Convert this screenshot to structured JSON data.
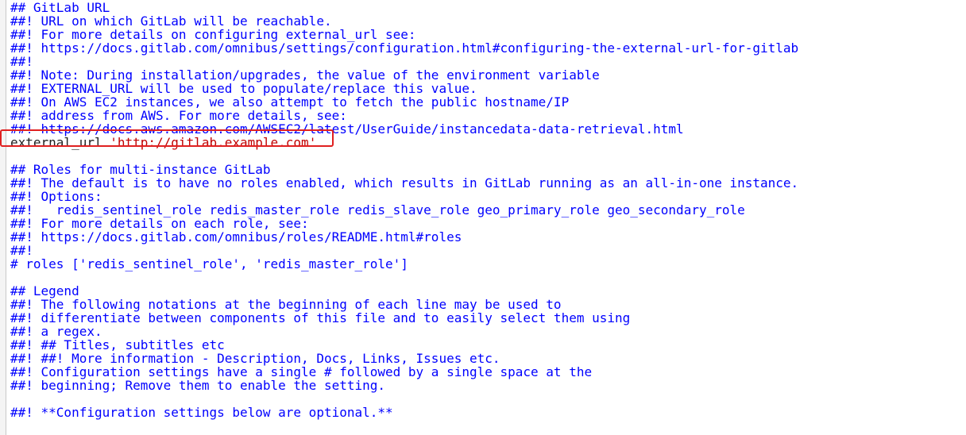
{
  "editor": {
    "lines": [
      {
        "text": "## GitLab URL"
      },
      {
        "text": "##! URL on which GitLab will be reachable."
      },
      {
        "text": "##! For more details on configuring external_url see:"
      },
      {
        "text": "##! https://docs.gitlab.com/omnibus/settings/configuration.html#configuring-the-external-url-for-gitlab"
      },
      {
        "text": "##!"
      },
      {
        "text": "##! Note: During installation/upgrades, the value of the environment variable"
      },
      {
        "text": "##! EXTERNAL_URL will be used to populate/replace this value."
      },
      {
        "text": "##! On AWS EC2 instances, we also attempt to fetch the public hostname/IP"
      },
      {
        "text": "##! address from AWS. For more details, see:"
      },
      {
        "text": "##! https://docs.aws.amazon.com/AWSEC2/latest/UserGuide/instancedata-data-retrieval.html"
      },
      {
        "text": "external_url ",
        "string": "'http://gitlab.example.com'"
      },
      {
        "text": ""
      },
      {
        "text": "## Roles for multi-instance GitLab"
      },
      {
        "text": "##! The default is to have no roles enabled, which results in GitLab running as an all-in-one instance."
      },
      {
        "text": "##! Options:"
      },
      {
        "text": "##!   redis_sentinel_role redis_master_role redis_slave_role geo_primary_role geo_secondary_role"
      },
      {
        "text": "##! For more details on each role, see:"
      },
      {
        "text": "##! https://docs.gitlab.com/omnibus/roles/README.html#roles"
      },
      {
        "text": "##!"
      },
      {
        "text": "# roles ['redis_sentinel_role', 'redis_master_role']"
      },
      {
        "text": ""
      },
      {
        "text": "## Legend"
      },
      {
        "text": "##! The following notations at the beginning of each line may be used to"
      },
      {
        "text": "##! differentiate between components of this file and to easily select them using"
      },
      {
        "text": "##! a regex."
      },
      {
        "text": "##! ## Titles, subtitles etc"
      },
      {
        "text": "##! ##! More information - Description, Docs, Links, Issues etc."
      },
      {
        "text": "##! Configuration settings have a single # followed by a single space at the"
      },
      {
        "text": "##! beginning; Remove them to enable the setting."
      },
      {
        "text": ""
      },
      {
        "text": "##! **Configuration settings below are optional.**"
      }
    ]
  },
  "colors": {
    "comment": "#0000ff",
    "code": "#202020",
    "string": "#c00000",
    "annotation_box": "#e02020"
  }
}
